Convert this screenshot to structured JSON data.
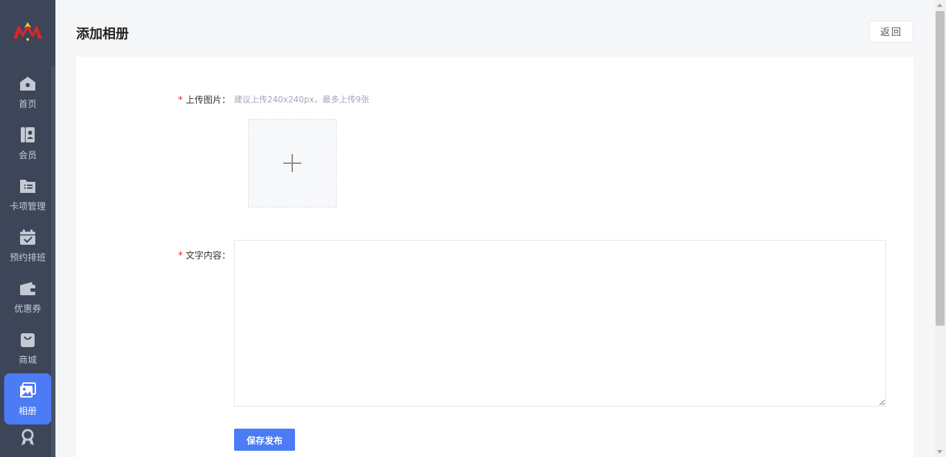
{
  "sidebar": {
    "items": [
      {
        "label": "首页",
        "icon": "home-icon"
      },
      {
        "label": "会员",
        "icon": "member-icon"
      },
      {
        "label": "卡项管理",
        "icon": "card-folder-icon"
      },
      {
        "label": "预约排班",
        "icon": "calendar-check-icon"
      },
      {
        "label": "优惠券",
        "icon": "wallet-icon"
      },
      {
        "label": "商城",
        "icon": "shopping-bag-icon"
      },
      {
        "label": "相册",
        "icon": "album-icon",
        "active": true
      },
      {
        "label": "",
        "icon": "award-icon"
      }
    ]
  },
  "header": {
    "title": "添加相册",
    "back_label": "返回"
  },
  "form": {
    "upload_label": "上传图片：",
    "upload_hint": "建议上传240x240px，最多上传9张",
    "content_label": "文字内容：",
    "content_value": "",
    "required_mark": "*",
    "save_label": "保存发布"
  },
  "colors": {
    "sidebar_bg": "#3d4658",
    "accent": "#4b7bf5",
    "required": "#e0312d"
  }
}
